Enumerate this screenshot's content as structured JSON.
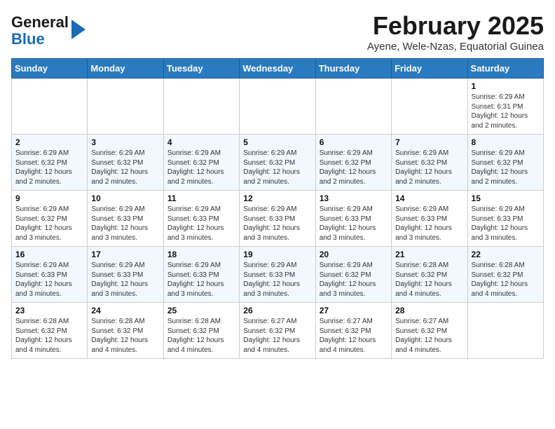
{
  "header": {
    "logo_general": "General",
    "logo_blue": "Blue",
    "month_title": "February 2025",
    "location": "Ayene, Wele-Nzas, Equatorial Guinea"
  },
  "weekdays": [
    "Sunday",
    "Monday",
    "Tuesday",
    "Wednesday",
    "Thursday",
    "Friday",
    "Saturday"
  ],
  "weeks": [
    [
      {
        "day": "",
        "info": ""
      },
      {
        "day": "",
        "info": ""
      },
      {
        "day": "",
        "info": ""
      },
      {
        "day": "",
        "info": ""
      },
      {
        "day": "",
        "info": ""
      },
      {
        "day": "",
        "info": ""
      },
      {
        "day": "1",
        "info": "Sunrise: 6:29 AM\nSunset: 6:31 PM\nDaylight: 12 hours and 2 minutes."
      }
    ],
    [
      {
        "day": "2",
        "info": "Sunrise: 6:29 AM\nSunset: 6:32 PM\nDaylight: 12 hours and 2 minutes."
      },
      {
        "day": "3",
        "info": "Sunrise: 6:29 AM\nSunset: 6:32 PM\nDaylight: 12 hours and 2 minutes."
      },
      {
        "day": "4",
        "info": "Sunrise: 6:29 AM\nSunset: 6:32 PM\nDaylight: 12 hours and 2 minutes."
      },
      {
        "day": "5",
        "info": "Sunrise: 6:29 AM\nSunset: 6:32 PM\nDaylight: 12 hours and 2 minutes."
      },
      {
        "day": "6",
        "info": "Sunrise: 6:29 AM\nSunset: 6:32 PM\nDaylight: 12 hours and 2 minutes."
      },
      {
        "day": "7",
        "info": "Sunrise: 6:29 AM\nSunset: 6:32 PM\nDaylight: 12 hours and 2 minutes."
      },
      {
        "day": "8",
        "info": "Sunrise: 6:29 AM\nSunset: 6:32 PM\nDaylight: 12 hours and 2 minutes."
      }
    ],
    [
      {
        "day": "9",
        "info": "Sunrise: 6:29 AM\nSunset: 6:32 PM\nDaylight: 12 hours and 3 minutes."
      },
      {
        "day": "10",
        "info": "Sunrise: 6:29 AM\nSunset: 6:33 PM\nDaylight: 12 hours and 3 minutes."
      },
      {
        "day": "11",
        "info": "Sunrise: 6:29 AM\nSunset: 6:33 PM\nDaylight: 12 hours and 3 minutes."
      },
      {
        "day": "12",
        "info": "Sunrise: 6:29 AM\nSunset: 6:33 PM\nDaylight: 12 hours and 3 minutes."
      },
      {
        "day": "13",
        "info": "Sunrise: 6:29 AM\nSunset: 6:33 PM\nDaylight: 12 hours and 3 minutes."
      },
      {
        "day": "14",
        "info": "Sunrise: 6:29 AM\nSunset: 6:33 PM\nDaylight: 12 hours and 3 minutes."
      },
      {
        "day": "15",
        "info": "Sunrise: 6:29 AM\nSunset: 6:33 PM\nDaylight: 12 hours and 3 minutes."
      }
    ],
    [
      {
        "day": "16",
        "info": "Sunrise: 6:29 AM\nSunset: 6:33 PM\nDaylight: 12 hours and 3 minutes."
      },
      {
        "day": "17",
        "info": "Sunrise: 6:29 AM\nSunset: 6:33 PM\nDaylight: 12 hours and 3 minutes."
      },
      {
        "day": "18",
        "info": "Sunrise: 6:29 AM\nSunset: 6:33 PM\nDaylight: 12 hours and 3 minutes."
      },
      {
        "day": "19",
        "info": "Sunrise: 6:29 AM\nSunset: 6:33 PM\nDaylight: 12 hours and 3 minutes."
      },
      {
        "day": "20",
        "info": "Sunrise: 6:29 AM\nSunset: 6:32 PM\nDaylight: 12 hours and 3 minutes."
      },
      {
        "day": "21",
        "info": "Sunrise: 6:28 AM\nSunset: 6:32 PM\nDaylight: 12 hours and 4 minutes."
      },
      {
        "day": "22",
        "info": "Sunrise: 6:28 AM\nSunset: 6:32 PM\nDaylight: 12 hours and 4 minutes."
      }
    ],
    [
      {
        "day": "23",
        "info": "Sunrise: 6:28 AM\nSunset: 6:32 PM\nDaylight: 12 hours and 4 minutes."
      },
      {
        "day": "24",
        "info": "Sunrise: 6:28 AM\nSunset: 6:32 PM\nDaylight: 12 hours and 4 minutes."
      },
      {
        "day": "25",
        "info": "Sunrise: 6:28 AM\nSunset: 6:32 PM\nDaylight: 12 hours and 4 minutes."
      },
      {
        "day": "26",
        "info": "Sunrise: 6:27 AM\nSunset: 6:32 PM\nDaylight: 12 hours and 4 minutes."
      },
      {
        "day": "27",
        "info": "Sunrise: 6:27 AM\nSunset: 6:32 PM\nDaylight: 12 hours and 4 minutes."
      },
      {
        "day": "28",
        "info": "Sunrise: 6:27 AM\nSunset: 6:32 PM\nDaylight: 12 hours and 4 minutes."
      },
      {
        "day": "",
        "info": ""
      }
    ]
  ]
}
